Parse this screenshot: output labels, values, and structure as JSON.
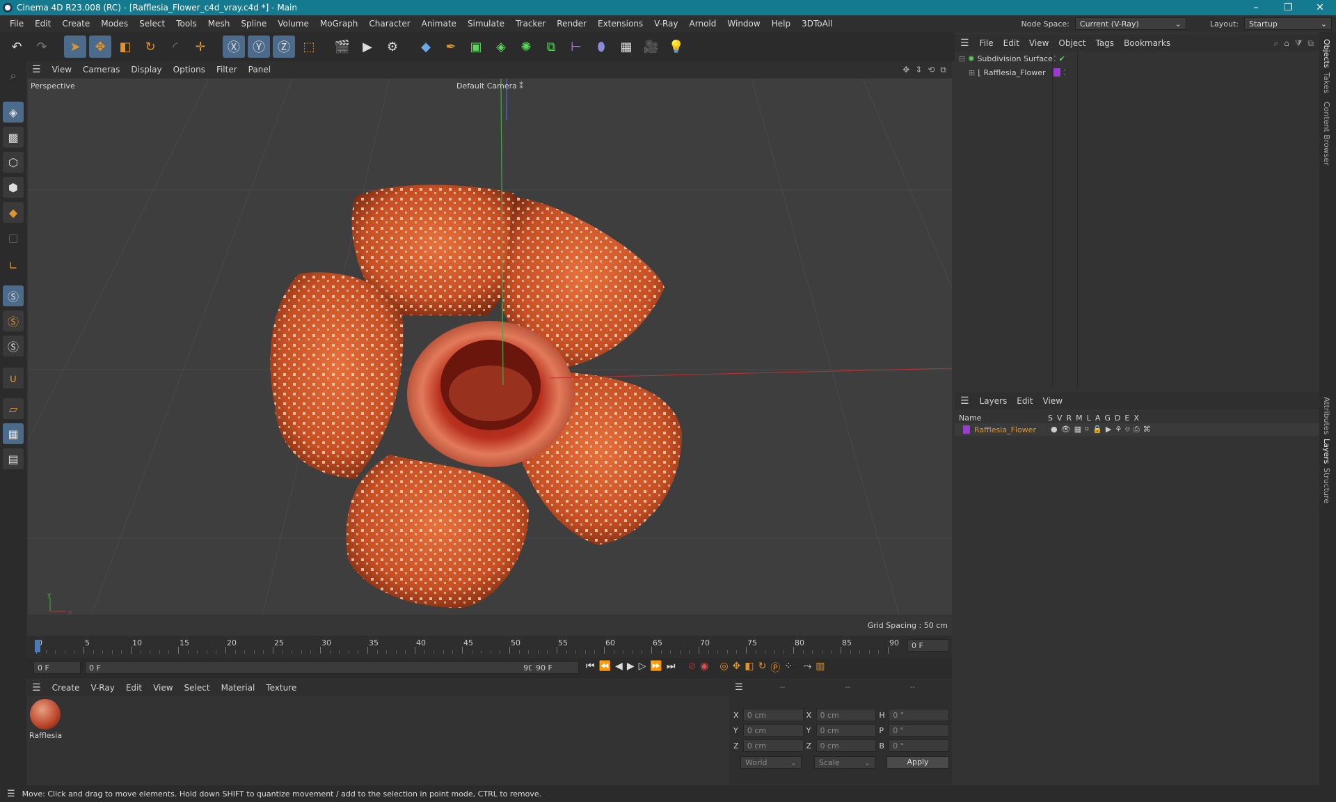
{
  "window": {
    "title": "Cinema 4D R23.008 (RC) - [Rafflesia_Flower_c4d_vray.c4d *] - Main",
    "minimize": "–",
    "maximize": "❐",
    "close": "✕"
  },
  "menubar": {
    "items": [
      "File",
      "Edit",
      "Create",
      "Modes",
      "Select",
      "Tools",
      "Mesh",
      "Spline",
      "Volume",
      "MoGraph",
      "Character",
      "Animate",
      "Simulate",
      "Tracker",
      "Render",
      "Extensions",
      "V-Ray",
      "Arnold",
      "Window",
      "Help",
      "3DToAll"
    ],
    "node_space_label": "Node Space:",
    "node_space_value": "Current (V-Ray)",
    "layout_label": "Layout:",
    "layout_value": "Startup"
  },
  "viewport": {
    "menu": [
      "View",
      "Cameras",
      "Display",
      "Options",
      "Filter",
      "Panel"
    ],
    "name": "Perspective",
    "camera": "Default Camera",
    "grid_spacing": "Grid Spacing : 50 cm",
    "axis_y": "y",
    "axis_x": "x"
  },
  "timeline": {
    "ticks": [
      "0",
      "5",
      "10",
      "15",
      "20",
      "25",
      "30",
      "35",
      "40",
      "45",
      "50",
      "55",
      "60",
      "65",
      "70",
      "75",
      "80",
      "85",
      "90"
    ],
    "current_frame": "0 F",
    "start_field": "0 F",
    "range_start": "0 F",
    "range_end": "90 F",
    "end_field": "90 F"
  },
  "material_manager": {
    "menu": [
      "Create",
      "V-Ray",
      "Edit",
      "View",
      "Select",
      "Material",
      "Texture"
    ],
    "materials": [
      {
        "name": "Rafflesia"
      }
    ]
  },
  "coordinates": {
    "headers": [
      "--",
      "--",
      "--"
    ],
    "rows": [
      {
        "a": "X",
        "av": "0 cm",
        "b": "X",
        "bv": "0 cm",
        "c": "H",
        "cv": "0 °"
      },
      {
        "a": "Y",
        "av": "0 cm",
        "b": "Y",
        "bv": "0 cm",
        "c": "P",
        "cv": "0 °"
      },
      {
        "a": "Z",
        "av": "0 cm",
        "b": "Z",
        "bv": "0 cm",
        "c": "B",
        "cv": "0 °"
      }
    ],
    "mode1": "World",
    "mode2": "Scale",
    "apply": "Apply"
  },
  "object_manager": {
    "menu": [
      "File",
      "Edit",
      "View",
      "Object",
      "Tags",
      "Bookmarks"
    ],
    "objects": [
      {
        "name": "Subdivision Surface"
      },
      {
        "name": "Rafflesia_Flower"
      }
    ]
  },
  "layers_manager": {
    "menu": [
      "Layers",
      "Edit",
      "View"
    ],
    "columns": {
      "name": "Name",
      "flags": [
        "S",
        "V",
        "R",
        "M",
        "L",
        "A",
        "G",
        "D",
        "E",
        "X"
      ]
    },
    "layers": [
      {
        "name": "Rafflesia_Flower",
        "color": "#9b3bd1"
      }
    ]
  },
  "right_tabs": [
    "Objects",
    "Takes",
    "Content Browser",
    "Attributes",
    "Layers",
    "Structure"
  ],
  "status": "Move: Click and drag to move elements. Hold down SHIFT to quantize movement / add to the selection in point mode, CTRL to remove.",
  "colors": {
    "accent": "#4c6a8a",
    "title_bar": "#137a8f",
    "orange": "#e0942a",
    "layer": "#9b3bd1"
  }
}
